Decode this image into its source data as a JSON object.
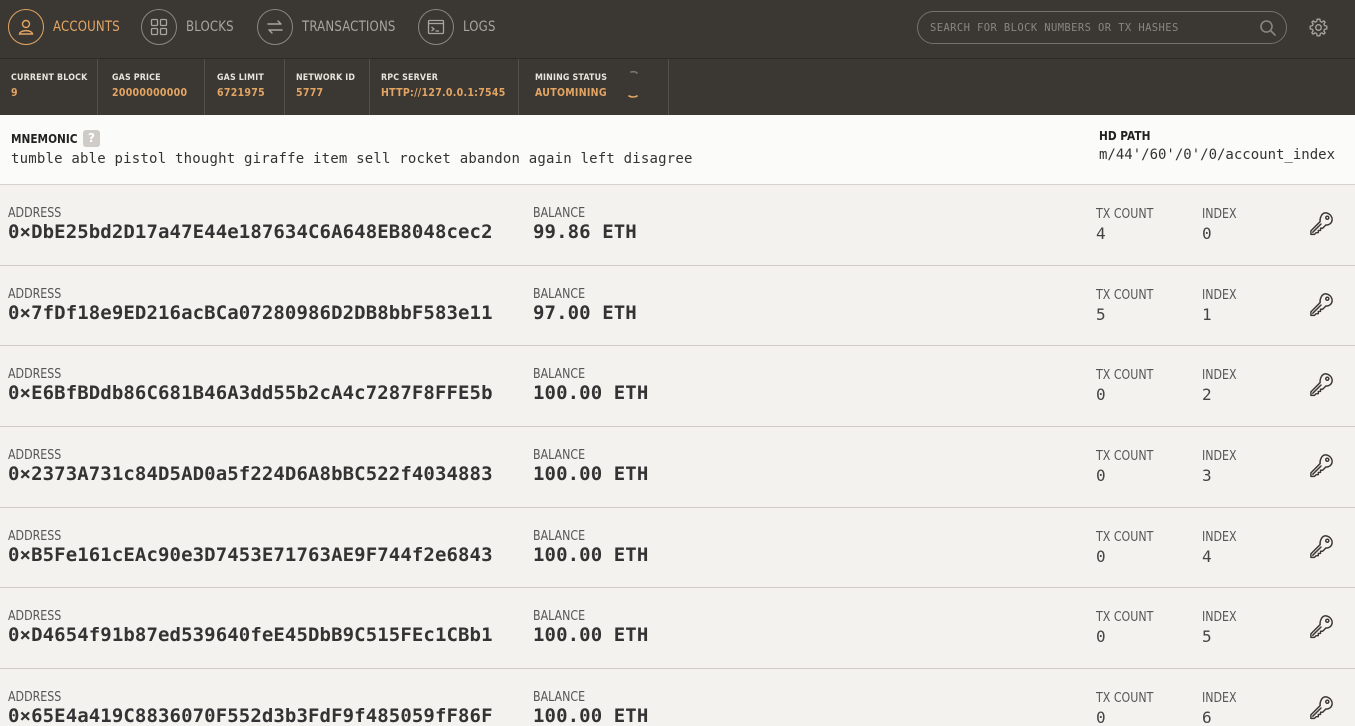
{
  "nav": {
    "items": [
      {
        "label": "ACCOUNTS",
        "icon": "user-icon",
        "active": true
      },
      {
        "label": "BLOCKS",
        "icon": "grid-icon",
        "active": false
      },
      {
        "label": "TRANSACTIONS",
        "icon": "swap-icon",
        "active": false
      },
      {
        "label": "LOGS",
        "icon": "terminal-icon",
        "active": false
      }
    ],
    "search_placeholder": "SEARCH FOR BLOCK NUMBERS OR TX HASHES",
    "accent_color": "#e3a563"
  },
  "status": {
    "current_block": {
      "label": "CURRENT BLOCK",
      "value": "9"
    },
    "gas_price": {
      "label": "GAS PRICE",
      "value": "20000000000"
    },
    "gas_limit": {
      "label": "GAS LIMIT",
      "value": "6721975"
    },
    "network_id": {
      "label": "NETWORK ID",
      "value": "5777"
    },
    "rpc_server": {
      "label": "RPC SERVER",
      "value": "HTTP://127.0.0.1:7545"
    },
    "mining_status": {
      "label": "MINING STATUS",
      "value": "AUTOMINING"
    }
  },
  "mnemonic": {
    "label": "MNEMONIC",
    "help": "?",
    "words": "tumble able pistol thought giraffe item sell rocket abandon again left disagree",
    "hd_path_label": "HD PATH",
    "hd_path": "m/44'/60'/0'/0/account_index"
  },
  "labels": {
    "address": "ADDRESS",
    "balance": "BALANCE",
    "tx_count": "TX COUNT",
    "index": "INDEX"
  },
  "accounts": [
    {
      "address": "0×DbE25bd2D17a47E44e187634C6A648EB8048cec2",
      "balance": "99.86 ETH",
      "tx_count": "4",
      "index": "0"
    },
    {
      "address": "0×7fDf18e9ED216acBCa07280986D2DB8bbF583e11",
      "balance": "97.00 ETH",
      "tx_count": "5",
      "index": "1"
    },
    {
      "address": "0×E6BfBDdb86C681B46A3dd55b2cA4c7287F8FFE5b",
      "balance": "100.00 ETH",
      "tx_count": "0",
      "index": "2"
    },
    {
      "address": "0×2373A731c84D5AD0a5f224D6A8bBC522f4034883",
      "balance": "100.00 ETH",
      "tx_count": "0",
      "index": "3"
    },
    {
      "address": "0×B5Fe161cEAc90e3D7453E71763AE9F744f2e6843",
      "balance": "100.00 ETH",
      "tx_count": "0",
      "index": "4"
    },
    {
      "address": "0×D4654f91b87ed539640feE45DbB9C515FEc1CBb1",
      "balance": "100.00 ETH",
      "tx_count": "0",
      "index": "5"
    },
    {
      "address": "0×65E4a419C8836070F552d3b3FdF9f485059fF86F",
      "balance": "100.00 ETH",
      "tx_count": "0",
      "index": "6"
    }
  ]
}
